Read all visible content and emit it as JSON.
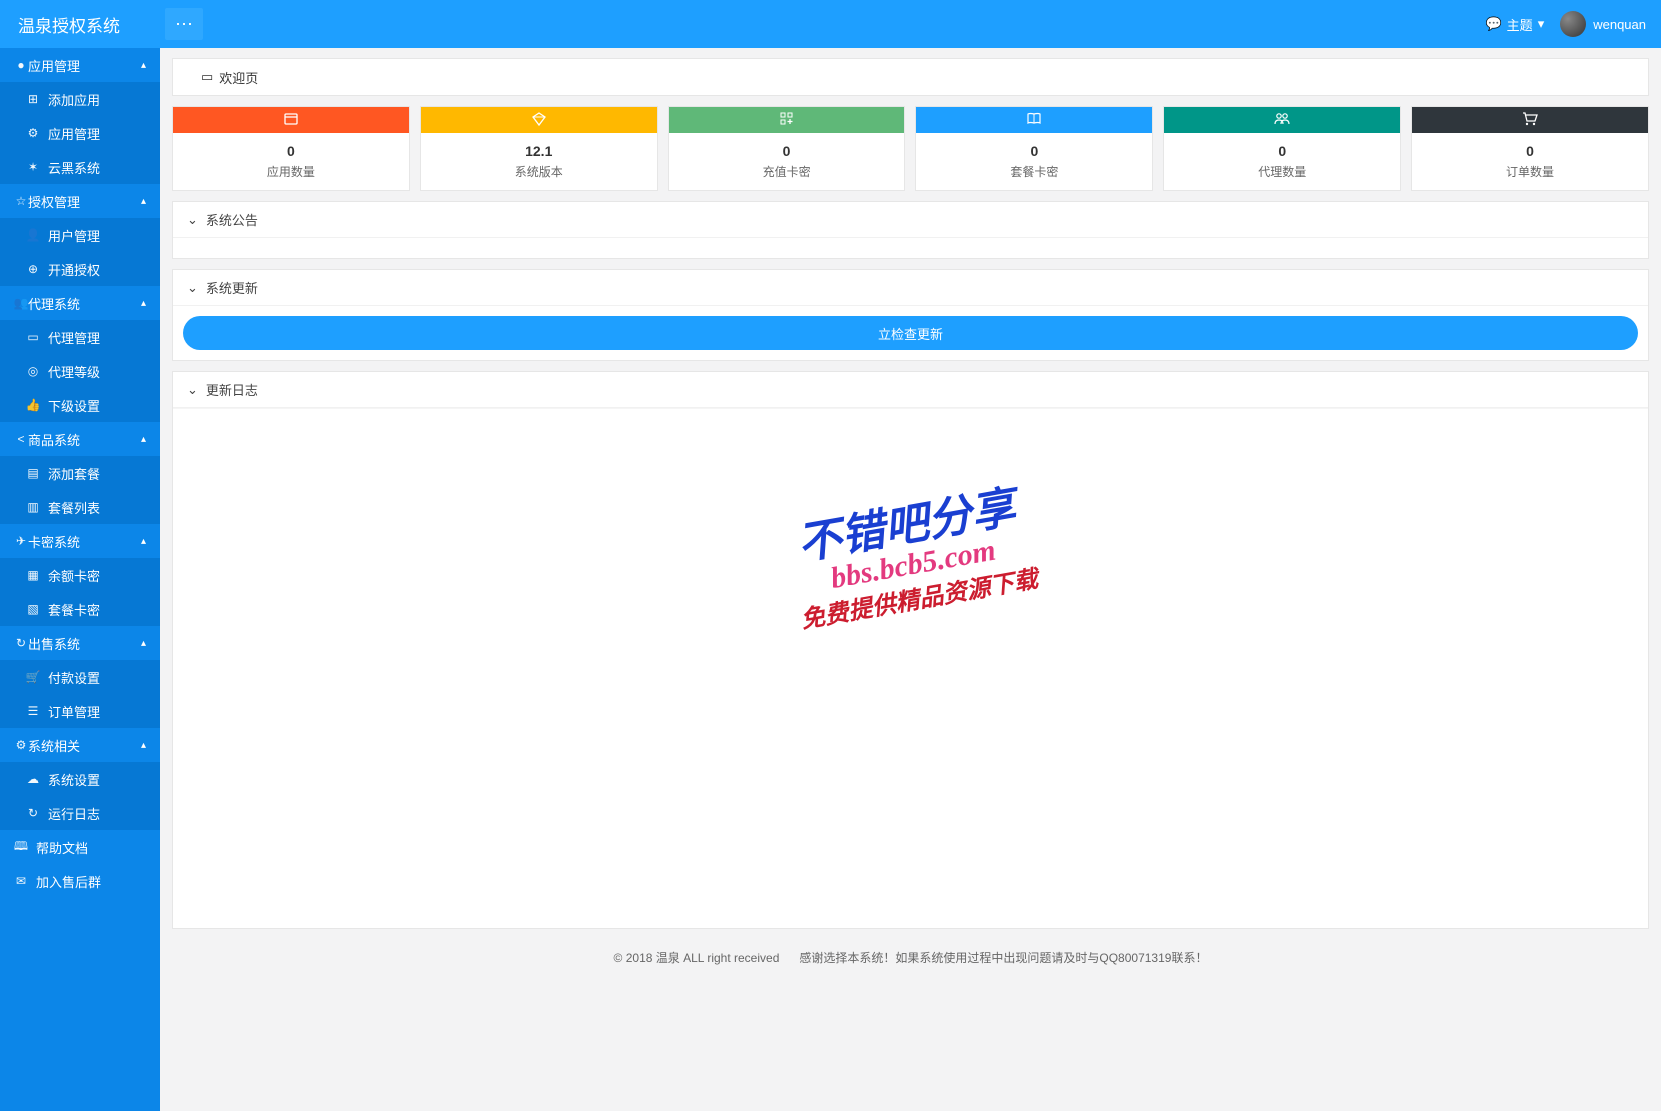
{
  "header": {
    "logo": "温泉授权系统",
    "theme_label": "主题",
    "username": "wenquan"
  },
  "sidebar": {
    "groups": [
      {
        "title": "应用管理",
        "icon": "●",
        "items": [
          {
            "label": "添加应用",
            "icon": "⊞"
          },
          {
            "label": "应用管理",
            "icon": "⚙"
          },
          {
            "label": "云黑系统",
            "icon": "✶"
          }
        ]
      },
      {
        "title": "授权管理",
        "icon": "☆",
        "items": [
          {
            "label": "用户管理",
            "icon": "👤"
          },
          {
            "label": "开通授权",
            "icon": "⊕"
          }
        ]
      },
      {
        "title": "代理系统",
        "icon": "👥",
        "items": [
          {
            "label": "代理管理",
            "icon": "▭"
          },
          {
            "label": "代理等级",
            "icon": "◎"
          },
          {
            "label": "下级设置",
            "icon": "👍"
          }
        ]
      },
      {
        "title": "商品系统",
        "icon": "<",
        "items": [
          {
            "label": "添加套餐",
            "icon": "▤"
          },
          {
            "label": "套餐列表",
            "icon": "▥"
          }
        ]
      },
      {
        "title": "卡密系统",
        "icon": "✈",
        "items": [
          {
            "label": "余额卡密",
            "icon": "▦"
          },
          {
            "label": "套餐卡密",
            "icon": "▧"
          }
        ]
      },
      {
        "title": "出售系统",
        "icon": "↻",
        "items": [
          {
            "label": "付款设置",
            "icon": "🛒"
          },
          {
            "label": "订单管理",
            "icon": "☰"
          }
        ]
      },
      {
        "title": "系统相关",
        "icon": "⚙",
        "items": [
          {
            "label": "系统设置",
            "icon": "☁"
          },
          {
            "label": "运行日志",
            "icon": "↻"
          }
        ]
      }
    ],
    "links": [
      {
        "label": "帮助文档",
        "icon": "🕮"
      },
      {
        "label": "加入售后群",
        "icon": "✉"
      }
    ]
  },
  "tabs": {
    "welcome": "欢迎页"
  },
  "stats": [
    {
      "value": "0",
      "label": "应用数量",
      "color": "#FF5722",
      "icon": "window"
    },
    {
      "value": "12.1",
      "label": "系统版本",
      "color": "#FFB800",
      "icon": "diamond"
    },
    {
      "value": "0",
      "label": "充值卡密",
      "color": "#5FB878",
      "icon": "grid-plus"
    },
    {
      "value": "0",
      "label": "套餐卡密",
      "color": "#1E9FFF",
      "icon": "book"
    },
    {
      "value": "0",
      "label": "代理数量",
      "color": "#009688",
      "icon": "users"
    },
    {
      "value": "0",
      "label": "订单数量",
      "color": "#2F363C",
      "icon": "cart"
    }
  ],
  "panels": {
    "announce": "系统公告",
    "update": "系统更新",
    "update_btn": "立检查更新",
    "changelog": "更新日志"
  },
  "watermark": {
    "l1": "不错吧分享",
    "l2": "bbs.bcb5.com",
    "l3": "免费提供精品资源下载"
  },
  "footer": {
    "copyright": "© 2018 温泉 ALL right received",
    "note": "感谢选择本系统！如果系统使用过程中出现问题请及时与QQ80071319联系！"
  }
}
